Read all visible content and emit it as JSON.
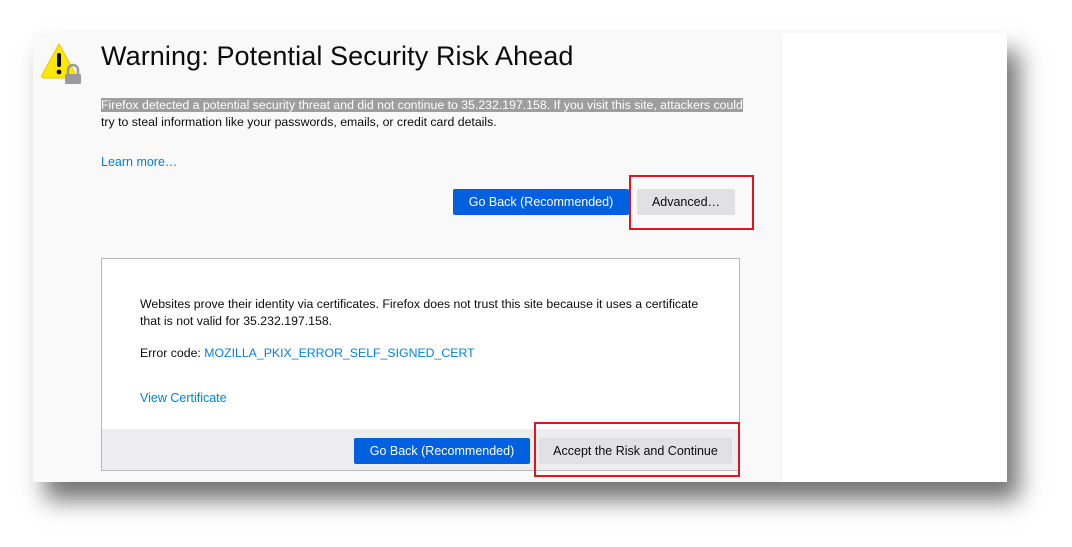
{
  "page": {
    "title": "Warning: Potential Security Risk Ahead",
    "description_highlighted": "Firefox detected a potential security threat and did not continue to 35.232.197.158. If you visit this site, attackers could",
    "description_rest": "try to steal information like your passwords, emails, or credit card details.",
    "learn_more": "Learn more…",
    "go_back_label": "Go Back (Recommended)",
    "advanced_label": "Advanced…"
  },
  "advanced_panel": {
    "explanation": "Websites prove their identity via certificates. Firefox does not trust this site because it uses a certificate that is not valid for 35.232.197.158.",
    "error_code_label": "Error code:",
    "error_code": "MOZILLA_PKIX_ERROR_SELF_SIGNED_CERT",
    "view_certificate": "View Certificate",
    "go_back_label": "Go Back (Recommended)",
    "accept_label": "Accept the Risk and Continue"
  },
  "icons": {
    "warning": "warning-triangle-lock-icon"
  },
  "colors": {
    "primary_button": "#0060df",
    "link": "#0a7ed4",
    "highlight_box": "#e0151b",
    "warning_yellow": "#ffe900"
  }
}
